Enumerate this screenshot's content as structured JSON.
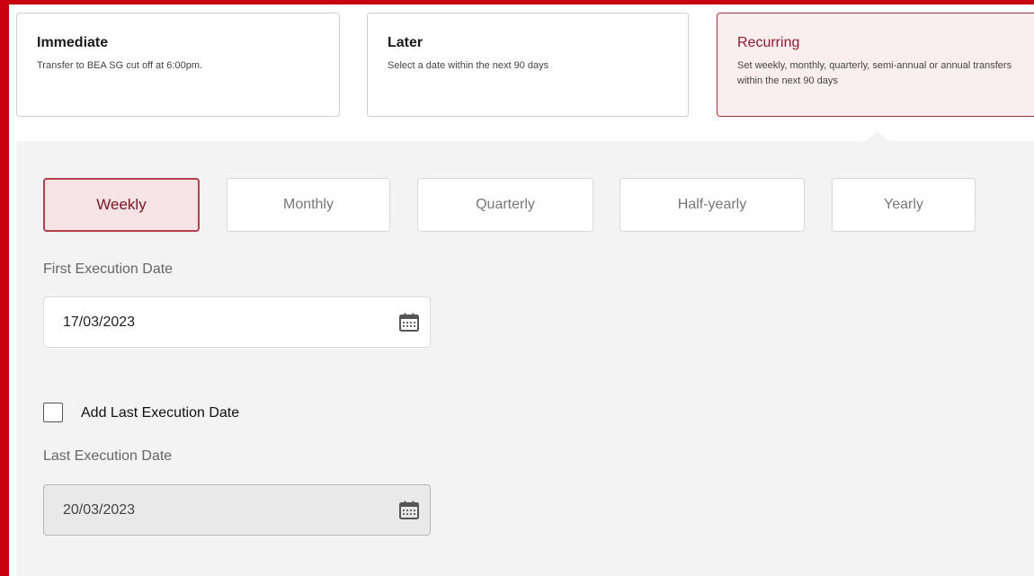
{
  "transfer_options": [
    {
      "title": "Immediate",
      "description": "Transfer to BEA SG cut off at 6:00pm.",
      "selected": false
    },
    {
      "title": "Later",
      "description": "Select a date within the next 90 days",
      "selected": false
    },
    {
      "title": "Recurring",
      "description": "Set weekly, monthly, quarterly, semi-annual or annual transfers within the next 90 days",
      "selected": true
    }
  ],
  "frequency": {
    "options": [
      "Weekly",
      "Monthly",
      "Quarterly",
      "Half-yearly",
      "Yearly"
    ],
    "selected": "Weekly"
  },
  "first_execution": {
    "label": "First Execution Date",
    "value": "17/03/2023"
  },
  "add_last_execution": {
    "label": "Add Last Execution Date",
    "checked": false
  },
  "last_execution": {
    "label": "Last Execution Date",
    "value": "20/03/2023",
    "disabled": true
  },
  "icons": {
    "date_picker": "calendar-icon",
    "checkbox": "checkbox-unchecked"
  },
  "colors": {
    "brand_red": "#c8000f",
    "selected_border": "#a83340",
    "selected_background": "#fbeeee",
    "panel_background": "#f3f3f3"
  }
}
